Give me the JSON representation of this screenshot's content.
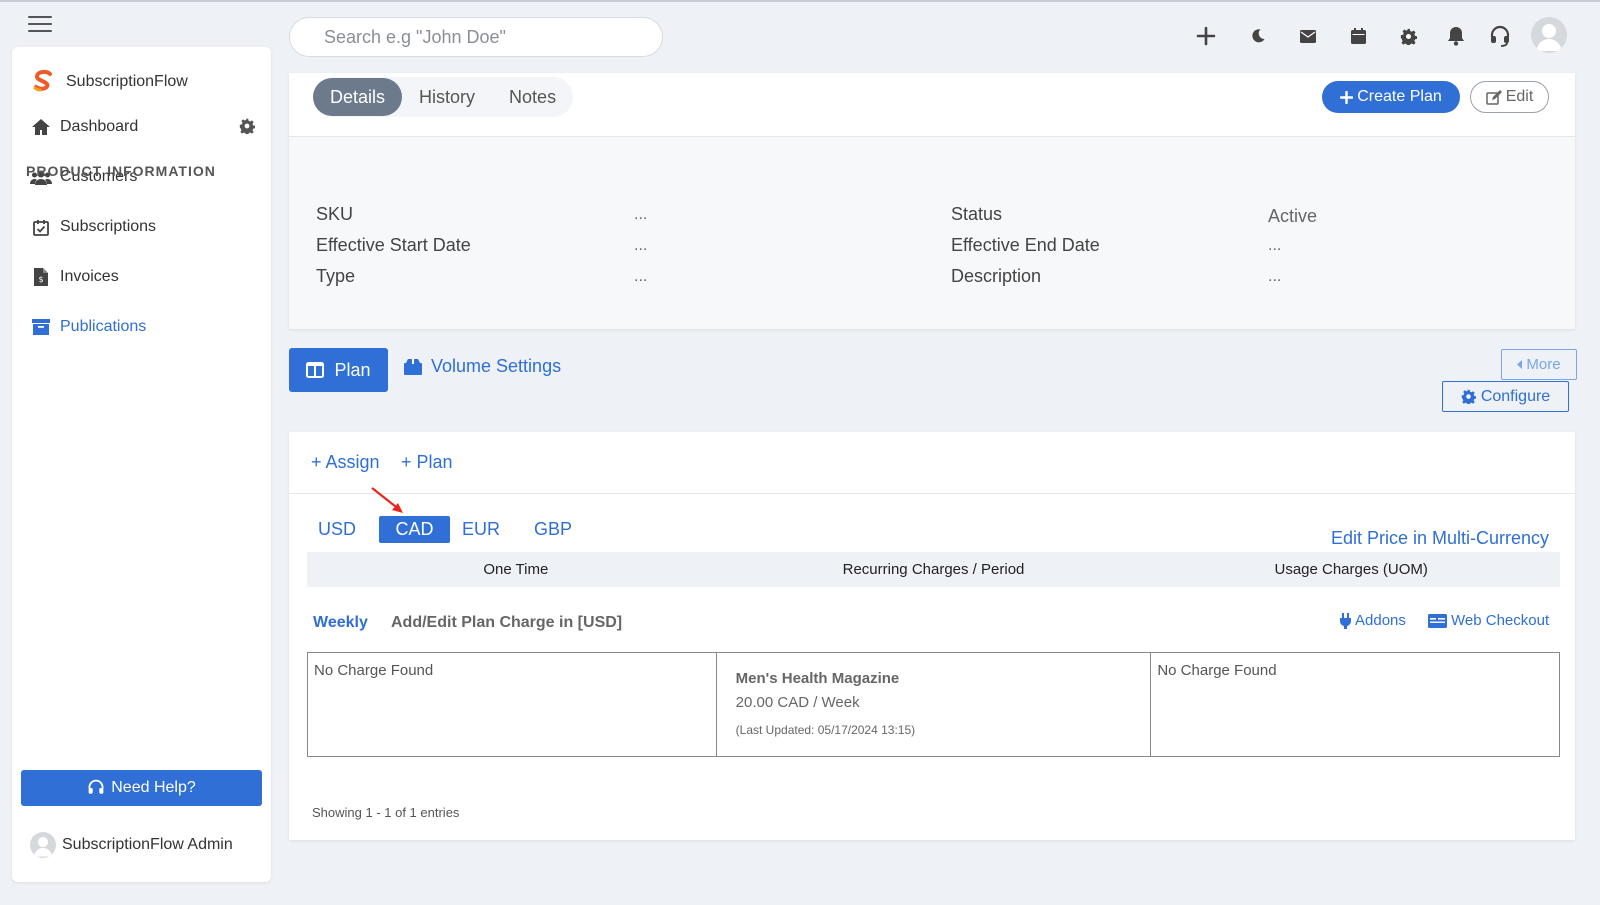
{
  "topbar": {
    "search_placeholder": "Search e.g \"John Doe\"",
    "icons": [
      "plus-icon",
      "moon-icon",
      "mail-icon",
      "calendar-icon",
      "gear-icon",
      "bell-icon",
      "headset-icon"
    ]
  },
  "sidebar": {
    "brand": "SubscriptionFlow",
    "items": [
      {
        "label": "Dashboard",
        "icon": "home-icon"
      },
      {
        "label": "Customers",
        "icon": "users-icon"
      },
      {
        "label": "Subscriptions",
        "icon": "calendar-check-icon"
      },
      {
        "label": "Invoices",
        "icon": "invoice-icon"
      },
      {
        "label": "Publications",
        "icon": "archive-icon",
        "active": true
      }
    ],
    "help_label": "Need Help?",
    "admin_name": "SubscriptionFlow Admin"
  },
  "tabs": [
    {
      "label": "Details",
      "active": true
    },
    {
      "label": "History"
    },
    {
      "label": "Notes"
    }
  ],
  "actions": {
    "create_plan": "Create Plan",
    "edit": "Edit"
  },
  "product_info": {
    "title": "PRODUCT INFORMATION",
    "fields": [
      {
        "label": "SKU",
        "value": "..."
      },
      {
        "label": "Status",
        "value": "Active"
      },
      {
        "label": "Effective Start Date",
        "value": "..."
      },
      {
        "label": "Effective End Date",
        "value": "..."
      },
      {
        "label": "Type",
        "value": "..."
      },
      {
        "label": "Description",
        "value": "..."
      }
    ]
  },
  "plan_tabs": {
    "plan": "Plan",
    "volume": "Volume Settings",
    "more": "More",
    "configure": "Configure"
  },
  "pricing": {
    "assign": "+ Assign",
    "plan": "+ Plan",
    "currencies": [
      {
        "code": "USD"
      },
      {
        "code": "CAD",
        "active": true
      },
      {
        "code": "EUR"
      },
      {
        "code": "GBP"
      }
    ],
    "edit_multi": "Edit Price in Multi-Currency",
    "columns": [
      "One Time",
      "Recurring Charges / Period",
      "Usage Charges (UOM)"
    ],
    "period": "Weekly",
    "add_edit": "Add/Edit Plan Charge in [USD]",
    "addons": "Addons",
    "web_checkout": "Web Checkout",
    "cells": {
      "one_time": "No Charge Found",
      "recurring": {
        "name": "Men's Health Magazine",
        "price": "20.00 CAD / Week",
        "updated": "(Last Updated: 05/17/2024 13:15)"
      },
      "usage": "No Charge Found"
    },
    "showing": "Showing 1 - 1 of 1 entries"
  },
  "colors": {
    "primary": "#2f6fd6",
    "annotation_arrow": "#e8281e"
  }
}
